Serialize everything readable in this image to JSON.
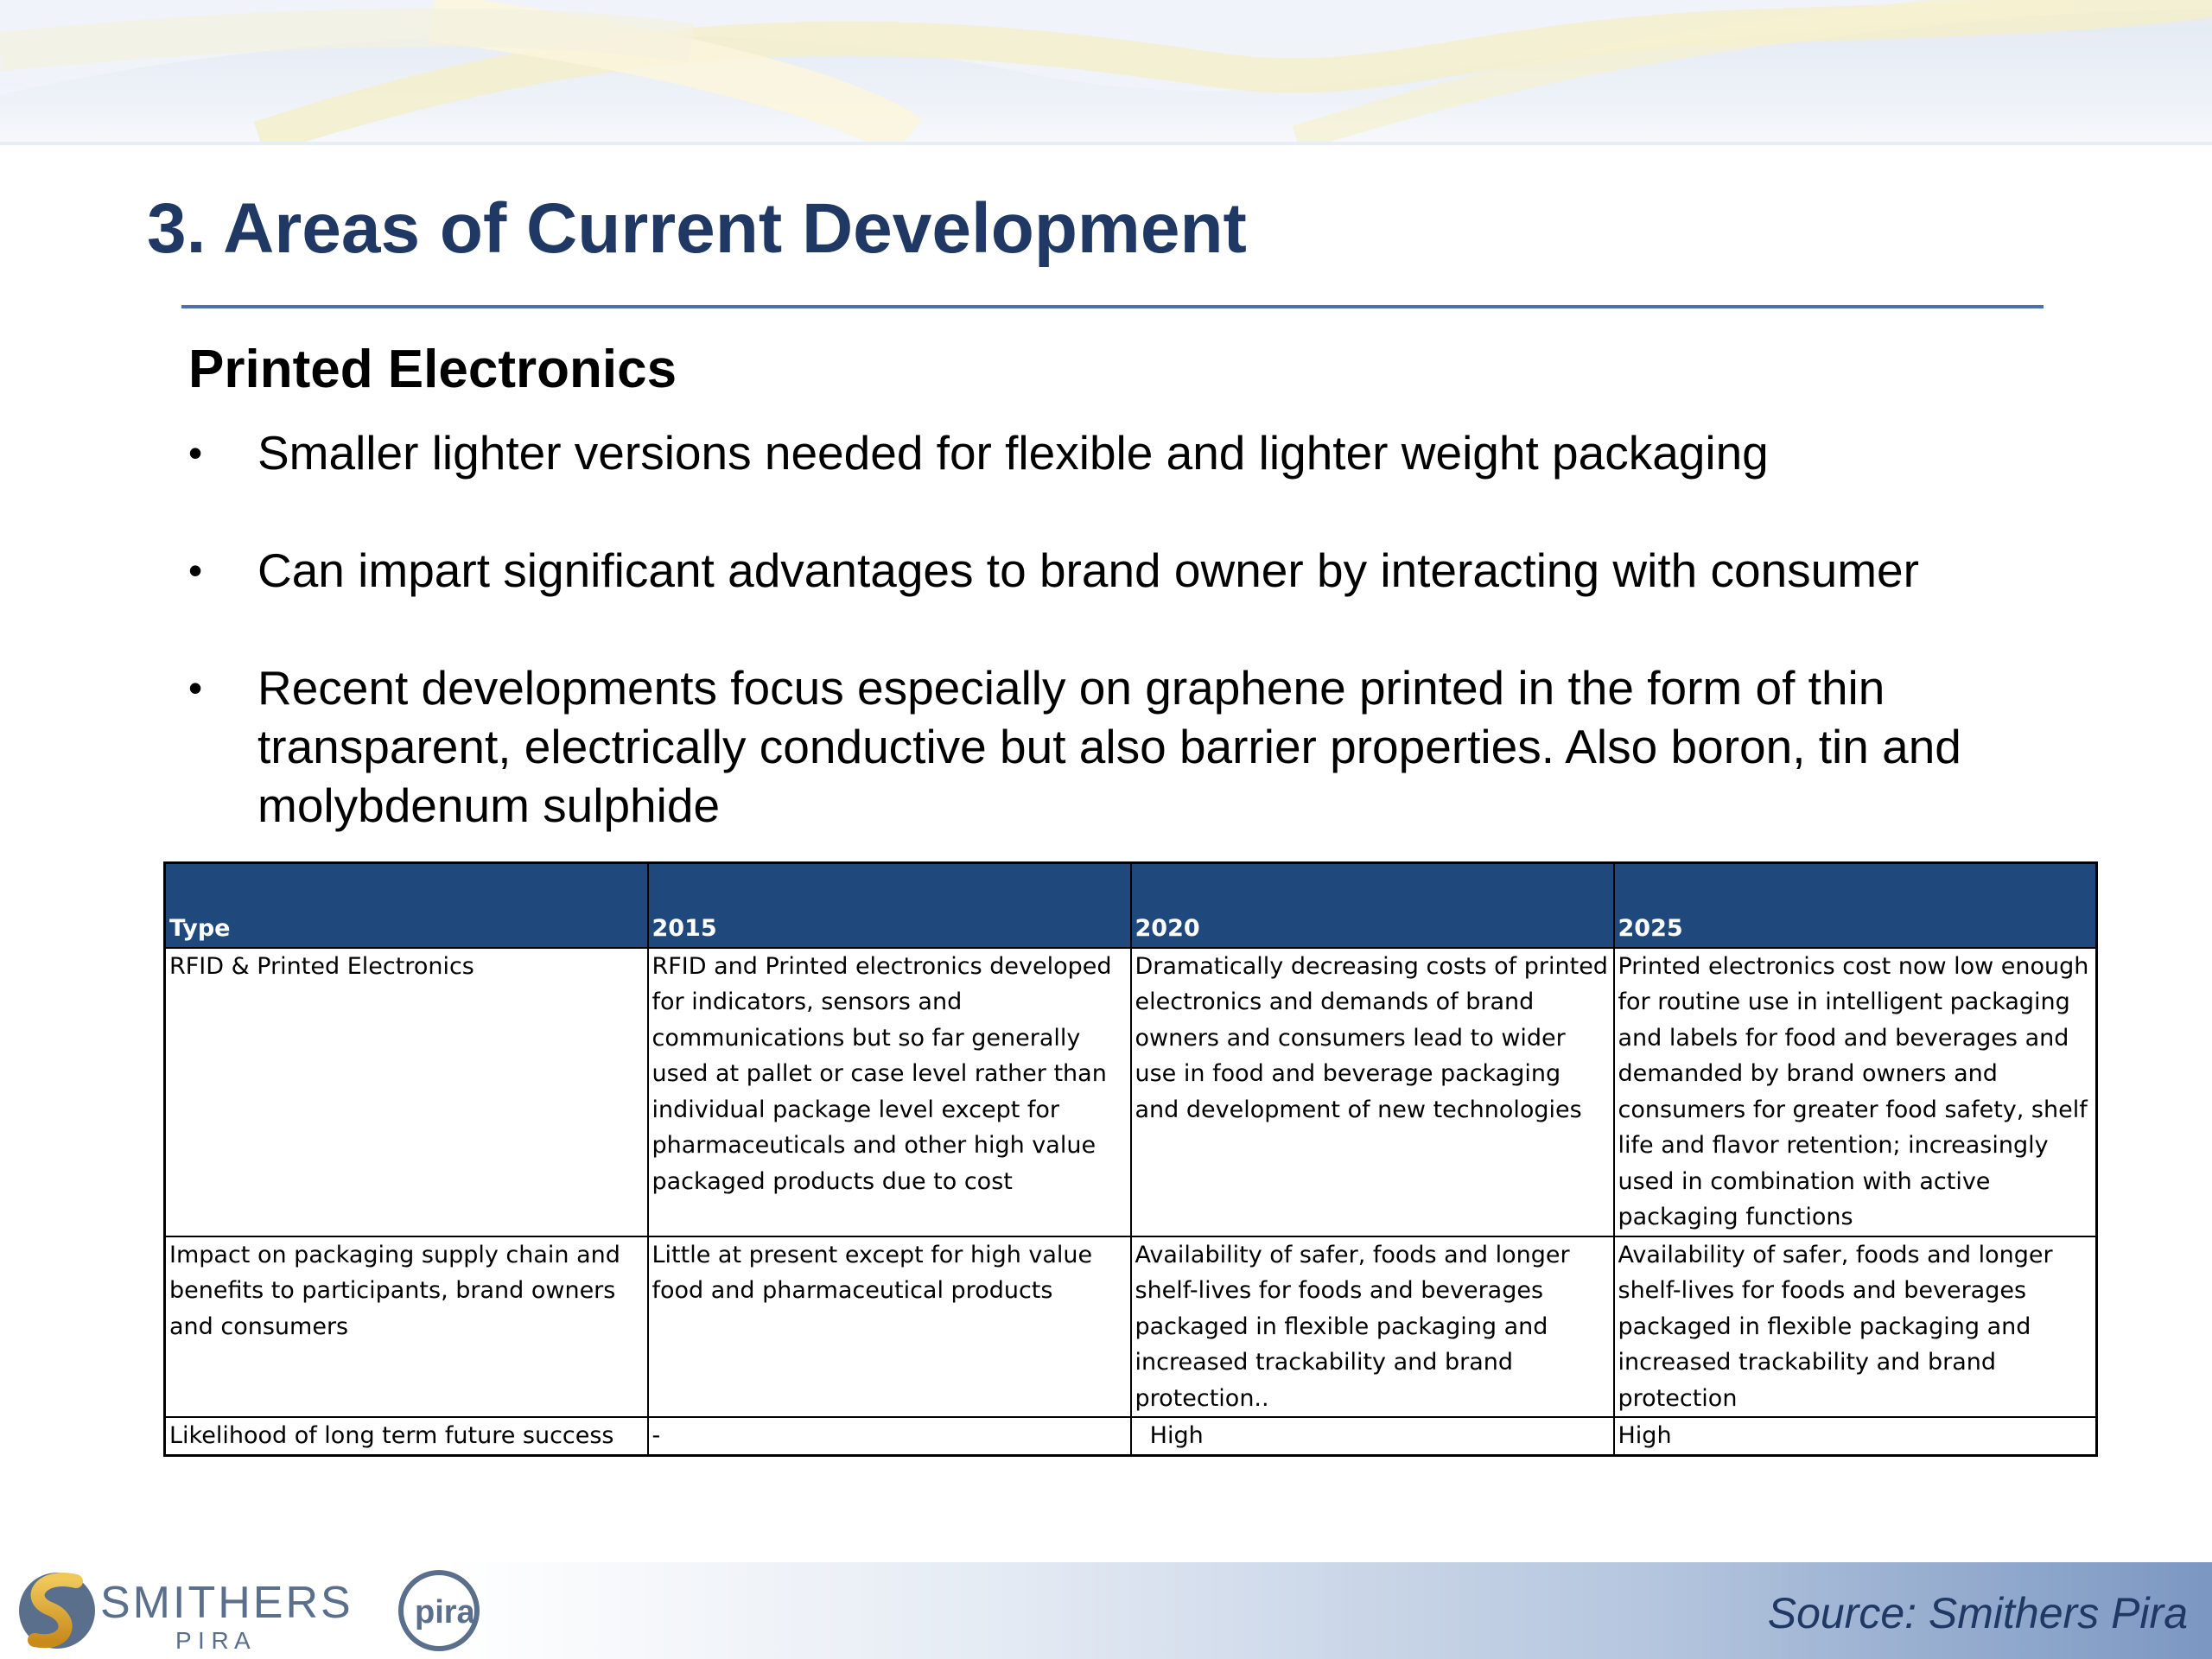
{
  "slide": {
    "title": "3. Areas of Current Development",
    "subtitle": "Printed Electronics",
    "bullets": [
      "Smaller lighter versions needed for flexible and lighter weight packaging",
      "Can impart significant advantages to brand owner by interacting with consumer",
      "Recent developments focus especially on graphene printed in the form of thin transparent, electrically conductive but also barrier properties.  Also boron, tin and molybdenum sulphide"
    ],
    "bullet_glyph": "•"
  },
  "table": {
    "headers": [
      "Type",
      "2015",
      "2020",
      "2025"
    ],
    "rows": [
      [
        "RFID & Printed Electronics",
        "RFID and Printed electronics developed for indicators, sensors and communications but so far generally used at  pallet or case level rather than individual package level except for pharmaceuticals and other high value packaged products due to cost",
        "Dramatically decreasing costs of printed electronics and demands of brand owners and consumers lead to wider use in food and beverage packaging and development of new technologies",
        "Printed electronics cost now low enough for routine use in intelligent packaging and labels for food and beverages and demanded by brand owners and consumers for greater food safety, shelf life and flavor retention;  increasingly used in combination with active packaging functions"
      ],
      [
        "Impact on packaging supply chain and benefits to participants, brand owners and consumers",
        "Little at present except for high value food and pharmaceutical products",
        "Availability of safer, foods and longer shelf-lives for foods and beverages packaged in flexible packaging and increased trackability and brand protection..",
        "Availability of safer, foods and longer shelf-lives for foods and beverages packaged in flexible packaging and increased trackability and brand protection"
      ],
      [
        "Likelihood of long term future success",
        "-",
        "  High",
        "High"
      ]
    ]
  },
  "footer": {
    "logo_text": "SMITHERS",
    "logo_subtext": "P I R A",
    "logo_badge": "pira",
    "source": "Source: Smithers Pira"
  },
  "colors": {
    "title": "#1f3864",
    "table_header": "#1f497d",
    "rule": "#4a72b0"
  }
}
